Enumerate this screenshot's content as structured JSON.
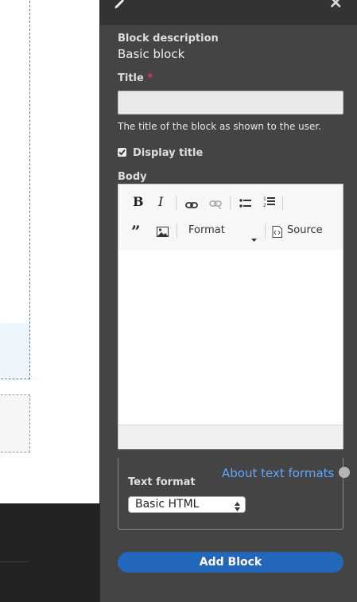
{
  "tray": {
    "block_description_label": "Block description",
    "block_description_value": "Basic block",
    "title_label": "Title",
    "title_required_mark": "*",
    "title_value": "",
    "title_description": "The title of the block as shown to the user.",
    "display_title_label": "Display title",
    "display_title_checked": true,
    "body_label": "Body",
    "editor": {
      "bold_icon": "bold-icon",
      "italic_icon": "italic-icon",
      "link_icon": "link-icon",
      "unlink_icon": "unlink-icon",
      "bulleted_list_icon": "bulleted-list-icon",
      "numbered_list_icon": "numbered-list-icon",
      "blockquote_icon": "blockquote-icon",
      "image_icon": "image-icon",
      "format_label": "Format",
      "source_label": "Source"
    },
    "about_text_formats_link": "About text formats",
    "text_format_label": "Text format",
    "text_format_selected": "Basic HTML",
    "add_block_label": "Add Block"
  },
  "colors": {
    "tray_background": "#444444",
    "accent_button": "#2267b9",
    "link": "#5fa8ff",
    "required": "#e0335a",
    "preview_outline": "#2e86d6"
  }
}
